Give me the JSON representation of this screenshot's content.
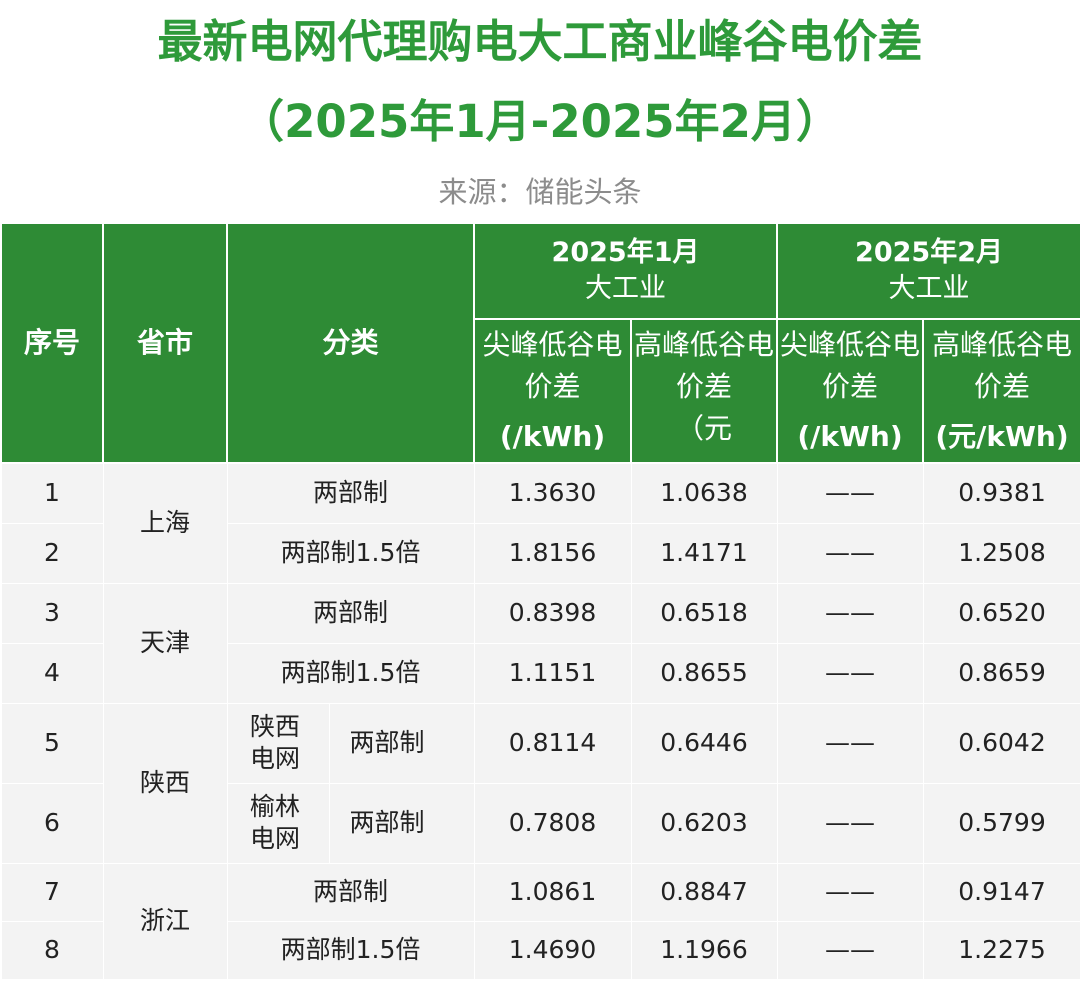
{
  "title_line1": "最新电网代理购电大工商业峰谷电价差",
  "title_line2": "（2025年1月-2025年2月）",
  "source": "来源：储能头条",
  "header": {
    "index": "序号",
    "province": "省市",
    "category": "分类",
    "jan_month": "2025年1月",
    "jan_type": "大工业",
    "feb_month": "2025年2月",
    "feb_type": "大工业",
    "peak_valley": "尖峰低谷电价差",
    "high_valley": "高峰低谷电价差",
    "unit_kwh": "(/kWh)",
    "unit_yuan": "（元",
    "unit_yuan_kwh": "(元/kWh)"
  },
  "dash": "——",
  "rows": [
    {
      "index": "1",
      "province": "上海",
      "category": "两部制",
      "jan_peak": "1.3630",
      "jan_high": "1.0638",
      "feb_high": "0.9381"
    },
    {
      "index": "2",
      "province": "上海",
      "category": "两部制1.5倍",
      "jan_peak": "1.8156",
      "jan_high": "1.4171",
      "feb_high": "1.2508"
    },
    {
      "index": "3",
      "province": "天津",
      "category": "两部制",
      "jan_peak": "0.8398",
      "jan_high": "0.6518",
      "feb_high": "0.6520"
    },
    {
      "index": "4",
      "province": "天津",
      "category": "两部制1.5倍",
      "jan_peak": "1.1151",
      "jan_high": "0.8655",
      "feb_high": "0.8659"
    },
    {
      "index": "5",
      "province": "陕西",
      "grid": "陕西电网",
      "category": "两部制",
      "jan_peak": "0.8114",
      "jan_high": "0.6446",
      "feb_high": "0.6042"
    },
    {
      "index": "6",
      "province": "陕西",
      "grid": "榆林电网",
      "category": "两部制",
      "jan_peak": "0.7808",
      "jan_high": "0.6203",
      "feb_high": "0.5799"
    },
    {
      "index": "7",
      "province": "浙江",
      "category": "两部制",
      "jan_peak": "1.0861",
      "jan_high": "0.8847",
      "feb_high": "0.9147"
    },
    {
      "index": "8",
      "province": "浙江",
      "category": "两部制1.5倍",
      "jan_peak": "1.4690",
      "jan_high": "1.1966",
      "feb_high": "1.2275"
    }
  ]
}
